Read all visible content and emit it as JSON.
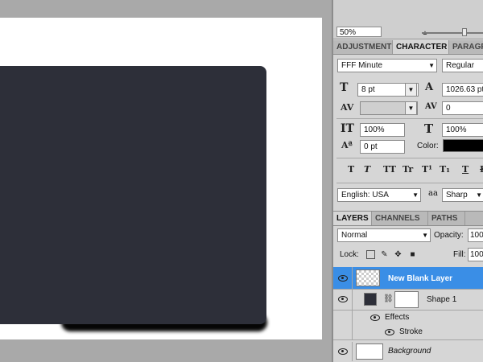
{
  "navigator": {
    "zoom_value": "50%"
  },
  "panel_tabs": [
    {
      "label": "ADJUSTMENT",
      "active": false
    },
    {
      "label": "CHARACTER",
      "active": true
    },
    {
      "label": "PARAGRA",
      "active": false
    }
  ],
  "character": {
    "font_family": "FFF Minute",
    "font_style": "Regular",
    "font_size": "8 pt",
    "leading": "1026.63 pt",
    "kerning": "",
    "tracking": "0",
    "vertical_scale": "100%",
    "horizontal_scale": "100%",
    "baseline_shift": "0 pt",
    "color_label": "Color:",
    "color_value": "#000000",
    "language": "English: USA",
    "antialias_icon": "aa",
    "antialias": "Sharp"
  },
  "style_buttons": [
    "T",
    "T",
    "TT",
    "Tr",
    "T¹",
    "T₁",
    "T",
    "F"
  ],
  "layers_tabs": [
    {
      "label": "LAYERS",
      "active": true
    },
    {
      "label": "CHANNELS",
      "active": false
    },
    {
      "label": "PATHS",
      "active": false
    }
  ],
  "layers_panel": {
    "blend_mode": "Normal",
    "opacity_label": "Opacity:",
    "opacity_value": "100",
    "lock_label": "Lock:",
    "fill_label": "Fill:",
    "fill_value": "100"
  },
  "layers": [
    {
      "name": "New Blank Layer",
      "selected": true
    },
    {
      "name": "Shape 1",
      "selected": false
    },
    {
      "name": "Effects",
      "selected": false
    },
    {
      "name": "Stroke",
      "selected": false
    },
    {
      "name": "Background",
      "selected": false
    }
  ],
  "colors": {
    "shape_fill": "#2d2f39",
    "selection": "#3a8ee6",
    "panel_bg": "#d6d6d6"
  }
}
